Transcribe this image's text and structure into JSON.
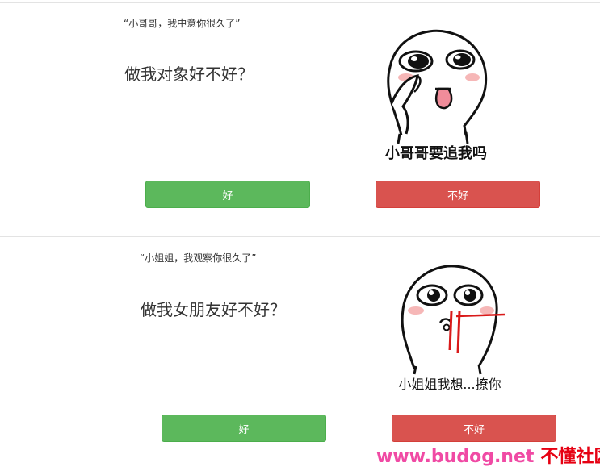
{
  "panel1": {
    "quote": "“小哥哥，我中意你很久了”",
    "question": "做我对象好不好？",
    "meme_caption": "小哥哥要追我吗",
    "ok_label": "好",
    "no_label": "不好"
  },
  "panel2": {
    "quote": "“小姐姐，我观察你很久了”",
    "question": "做我女朋友好不好？",
    "meme_caption": "小姐姐我想...撩你",
    "ok_label": "好",
    "no_label": "不好"
  },
  "watermark": {
    "url": "www.budog.net",
    "site_name": "不懂社区"
  },
  "colors": {
    "ok_button": "#5cb85c",
    "no_button": "#d9534f",
    "blush": "#f6b7b7",
    "tongue": "#f08c9a",
    "blood": "#d91a1a",
    "watermark_url": "#f04aa4",
    "watermark_name": "#e60012"
  }
}
